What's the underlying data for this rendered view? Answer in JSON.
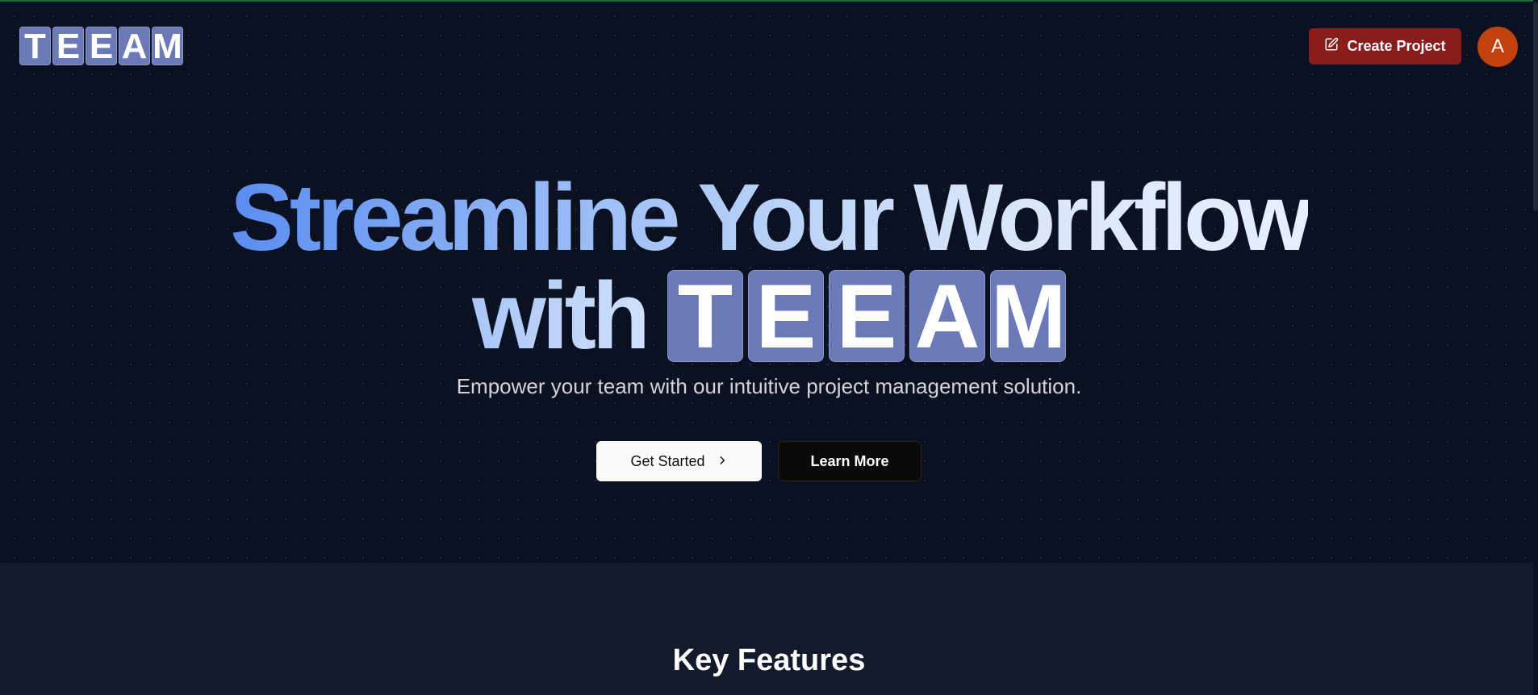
{
  "header": {
    "logo_letters": [
      "T",
      "E",
      "E",
      "A",
      "M"
    ],
    "create_button_label": "Create Project",
    "create_button_icon": "edit-icon",
    "avatar_initial": "A"
  },
  "hero": {
    "headline_line1": "Streamline Your Workflow",
    "headline_with": "with",
    "brand_letters": [
      "T",
      "E",
      "E",
      "A",
      "M"
    ],
    "subtitle": "Empower your team with our intuitive project management solution.",
    "primary_button": "Get Started",
    "primary_button_icon": "chevron-right-icon",
    "secondary_button": "Learn More"
  },
  "features": {
    "title": "Key Features"
  },
  "colors": {
    "background": "#0b1120",
    "tile": "#6b79b7",
    "create_button": "#8a1c1c",
    "avatar": "#c2410c"
  }
}
